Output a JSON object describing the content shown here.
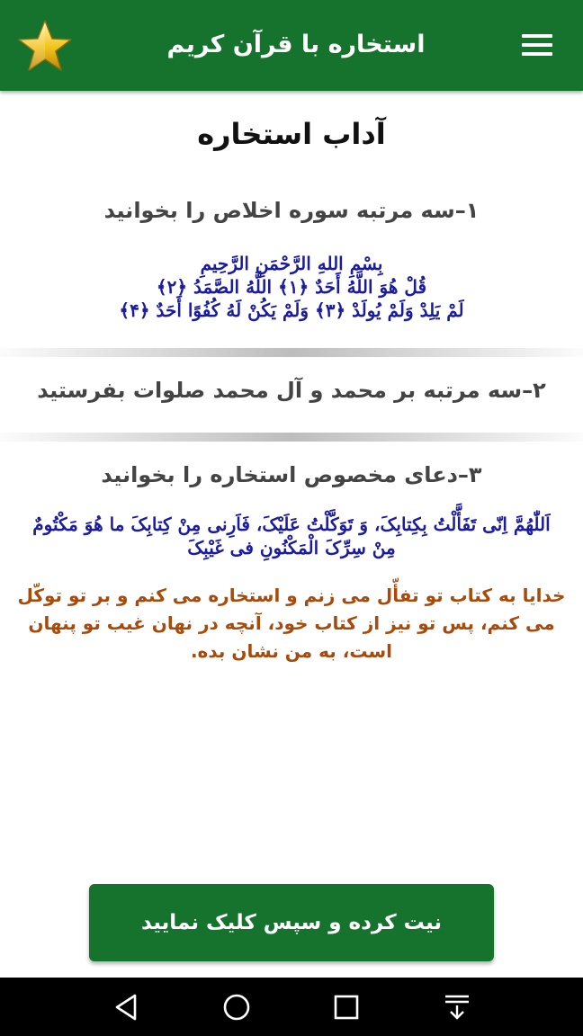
{
  "header": {
    "title": "استخاره با قرآن کریم",
    "star_icon": "star-icon",
    "menu_icon": "hamburger-menu-icon",
    "color": "#16732e"
  },
  "content": {
    "page_title": "آداب استخاره",
    "step1": {
      "label": "۱–سه مرتبه سوره اخلاص را بخوانید",
      "lines": [
        "بِسْمِ اللهِ الرَّحْمَنِ الرَّحِیمِ",
        "قُلْ هُوَ اللَّهُ أَحَدٌ ﴿۱﴾ اللَّهُ الصَّمَدُ ﴿۲﴾",
        "لَمْ يَلِدْ وَلَمْ يُولَدْ ﴿۳﴾ وَلَمْ يَكُنْ لَهُ كُفُوًا أَحَدٌ ﴿۴﴾"
      ]
    },
    "step2": {
      "label": "۲–سه مرتبه بر محمد و آل محمد صلوات بفرستید"
    },
    "step3": {
      "label": "۳–دعای مخصوص استخاره را بخوانید",
      "dua": "اَللّٰهُمَّ اِنّی تَفَأَّلْتُ بِکِتابِکَ، وَ تَوَکَّلْتُ عَلَیْکَ، فَاَرِنی مِنْ کِتابِکَ ما هُوَ مَکْتُومٌ مِنْ سِرِّکَ الْمَکْنُونِ فی غَیْبِکَ",
      "translation": "خدایا به کتاب تو تفأّل می زنم و استخاره می کنم و بر تو توکّل می کنم، پس تو نیز از کتاب خود، آنچه در نهان غیب تو پنهان است، به من نشان بده."
    }
  },
  "action_button": {
    "label": "نیت کرده و سپس کلیک نمایید"
  },
  "navbar": {
    "icons": [
      "back-icon",
      "home-icon",
      "recents-icon",
      "notifications-icon"
    ]
  }
}
